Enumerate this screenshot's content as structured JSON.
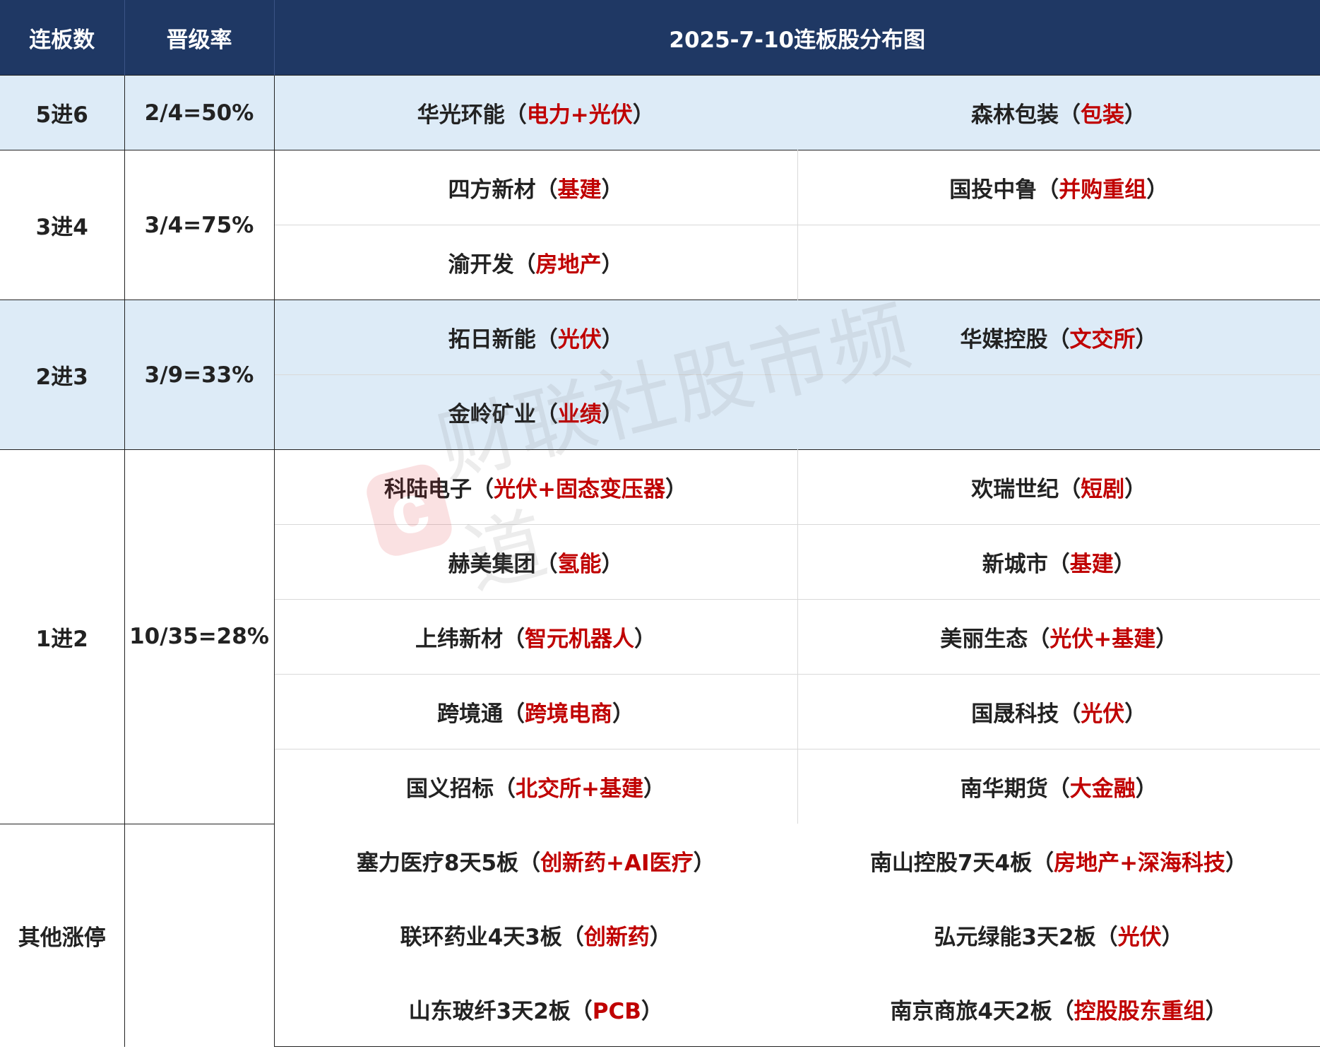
{
  "header": {
    "col1": "连板数",
    "col2": "晋级率",
    "title": "2025-7-10连板股分布图"
  },
  "groups": [
    {
      "level": "5进6",
      "rate": "2/4=50%",
      "rows": [
        [
          {
            "name": "华光环能",
            "tag": "电力+光伏"
          },
          {
            "name": "森林包装",
            "tag": "包装"
          }
        ]
      ]
    },
    {
      "level": "3进4",
      "rate": "3/4=75%",
      "rows": [
        [
          {
            "name": "四方新材",
            "tag": "基建"
          },
          {
            "name": "国投中鲁",
            "tag": "并购重组"
          }
        ],
        [
          {
            "name": "渝开发",
            "tag": "房地产"
          },
          null
        ]
      ]
    },
    {
      "level": "2进3",
      "rate": "3/9=33%",
      "rows": [
        [
          {
            "name": "拓日新能",
            "tag": "光伏"
          },
          {
            "name": "华媒控股",
            "tag": "文交所"
          }
        ],
        [
          {
            "name": "金岭矿业",
            "tag": "业绩"
          },
          null
        ]
      ]
    },
    {
      "level": "1进2",
      "rate": "10/35=28%",
      "rows": [
        [
          {
            "name": "科陆电子",
            "tag": "光伏+固态变压器"
          },
          {
            "name": "欢瑞世纪",
            "tag": "短剧"
          }
        ],
        [
          {
            "name": "赫美集团",
            "tag": "氢能"
          },
          {
            "name": "新城市",
            "tag": "基建"
          }
        ],
        [
          {
            "name": "上纬新材",
            "tag": "智元机器人"
          },
          {
            "name": "美丽生态",
            "tag": "光伏+基建"
          }
        ],
        [
          {
            "name": "跨境通",
            "tag": "跨境电商"
          },
          {
            "name": "国晟科技",
            "tag": "光伏"
          }
        ],
        [
          {
            "name": "国义招标",
            "tag": "北交所+基建"
          },
          {
            "name": "南华期货",
            "tag": "大金融"
          }
        ]
      ]
    },
    {
      "level": "其他涨停",
      "rate": "",
      "rows": [
        [
          {
            "name": "塞力医疗8天5板",
            "tag": "创新药+AI医疗"
          },
          {
            "name": "南山控股7天4板",
            "tag": "房地产+深海科技"
          }
        ],
        [
          {
            "name": "联环药业4天3板",
            "tag": "创新药"
          },
          {
            "name": "弘元绿能3天2板",
            "tag": "光伏"
          }
        ],
        [
          {
            "name": "山东玻纤3天2板",
            "tag": "PCB"
          },
          {
            "name": "南京商旅4天2板",
            "tag": "控股股东重组"
          }
        ]
      ]
    }
  ],
  "watermark": {
    "logo": "c",
    "text": "财联社股市频道"
  },
  "colors": {
    "header_bg": "#1f3864",
    "band_blue": "#ddebf7",
    "tag_red": "#c00000"
  }
}
